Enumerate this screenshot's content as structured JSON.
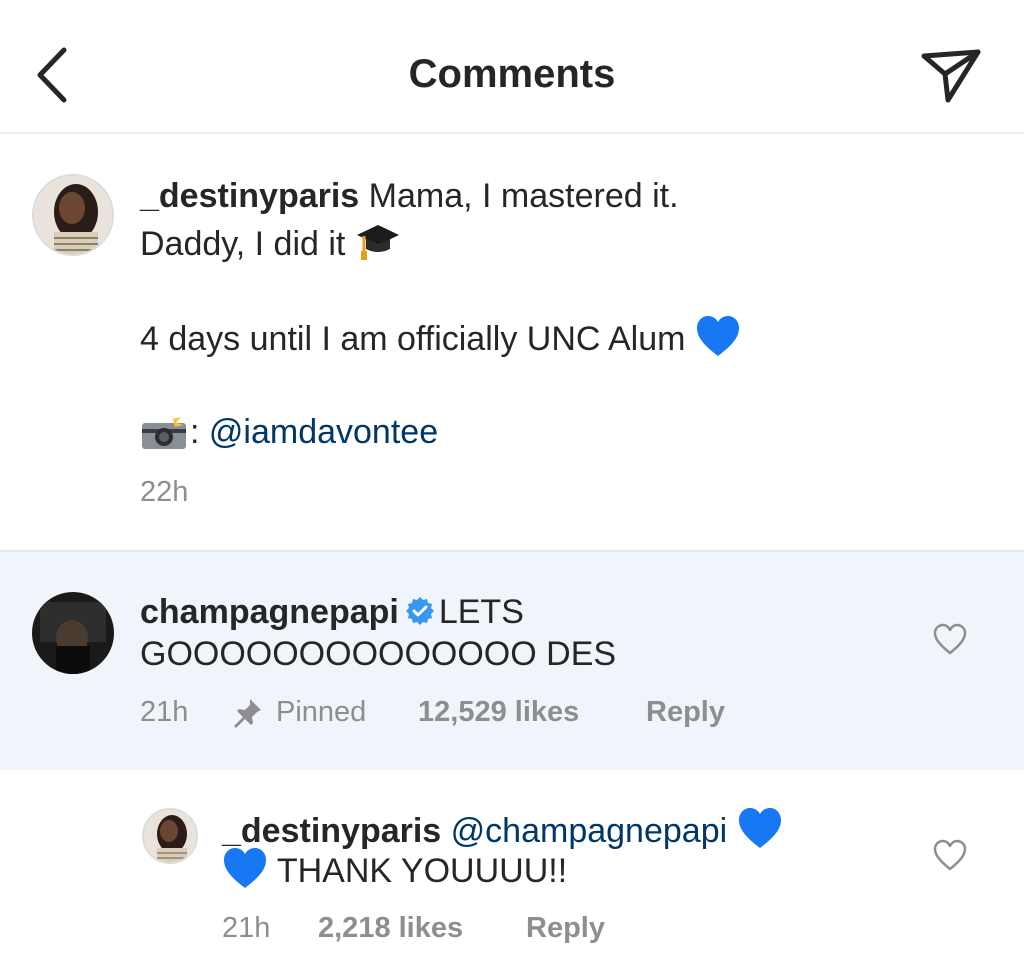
{
  "header": {
    "title": "Comments"
  },
  "caption": {
    "username": "_destinyparis",
    "line1": "Mama, I mastered it.",
    "line2": "Daddy, I did it",
    "line3": "4 days until I am officially UNC Alum",
    "photo_credit_prefix": ":",
    "photo_credit_mention": "@iamdavontee",
    "time": "22h"
  },
  "pinned_comment": {
    "username": "champagnepapi",
    "text_part1": "LETS",
    "text_part2": "GOOOOOOOOOOOOOO DES",
    "time": "21h",
    "pinned_label": "Pinned",
    "likes": "12,529 likes",
    "reply_label": "Reply"
  },
  "reply_comment": {
    "username": "_destinyparis",
    "mention": "@champagnepapi",
    "text": "THANK YOUUUU!!",
    "time": "21h",
    "likes": "2,218 likes",
    "reply_label": "Reply"
  },
  "colors": {
    "mention": "#00376b",
    "verified": "#3897f0",
    "meta": "#8e8e8e",
    "pinned_bg": "#eff5fb",
    "heart_emoji": "#1877f2"
  },
  "icons": [
    "back-icon",
    "send-icon",
    "verified-badge-icon",
    "pin-icon",
    "heart-icon",
    "graduation-cap-emoji",
    "blue-heart-emoji",
    "camera-flash-emoji"
  ]
}
